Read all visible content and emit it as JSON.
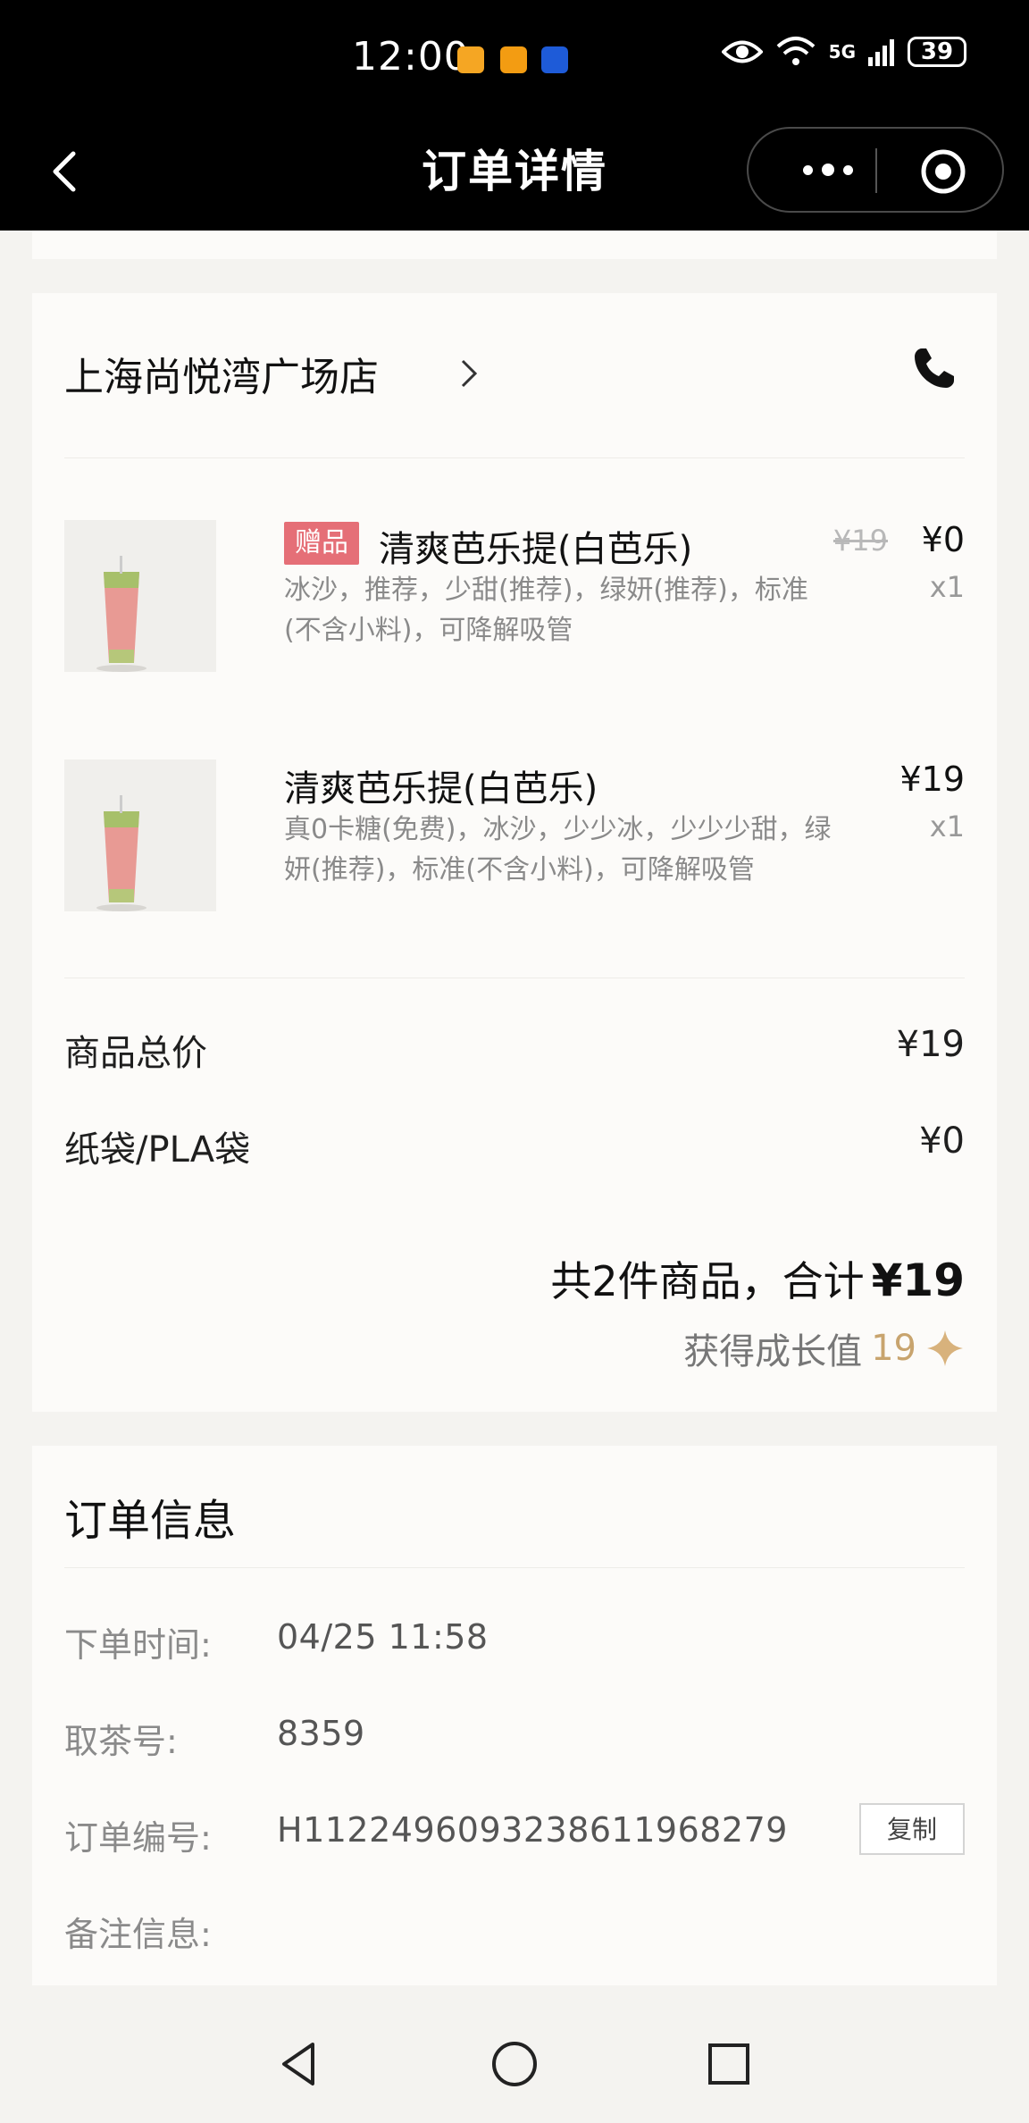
{
  "status_bar": {
    "time": "12:00",
    "network": "5G",
    "battery": "39"
  },
  "nav": {
    "title": "订单详情"
  },
  "store": {
    "name": "上海尚悦湾广场店"
  },
  "items": [
    {
      "badge": "赠品",
      "name": "清爽芭乐提(白芭乐)",
      "desc": "冰沙，推荐，少甜(推荐)，绿妍(推荐)，标准(不含小料)，可降解吸管",
      "price_old": "¥19",
      "price": "¥0",
      "qty": "x1"
    },
    {
      "name": "清爽芭乐提(白芭乐)",
      "desc": "真0卡糖(免费)，冰沙，少少冰，少少少甜，绿妍(推荐)，标准(不含小料)，可降解吸管",
      "price": "¥19",
      "qty": "x1"
    }
  ],
  "summary": {
    "goods_total_label": "商品总价",
    "goods_total_value": "¥19",
    "bag_label": "纸袋/PLA袋",
    "bag_value": "¥0",
    "total_prefix": "共2件商品，合计",
    "total_amount": "¥19",
    "growth_label": "获得成长值",
    "growth_value": "19"
  },
  "order_info": {
    "title": "订单信息",
    "rows": [
      {
        "label": "下单时间:",
        "value": "04/25 11:58"
      },
      {
        "label": "取茶号:",
        "value": "8359"
      },
      {
        "label": "订单编号:",
        "value": "H112249609323861196827​9"
      },
      {
        "label": "备注信息:",
        "value": ""
      }
    ],
    "copy_label": "复制"
  },
  "colors": {
    "gift_badge": "#e56f77",
    "growth_accent": "#c8a46e",
    "background": "#f4f3f0"
  }
}
